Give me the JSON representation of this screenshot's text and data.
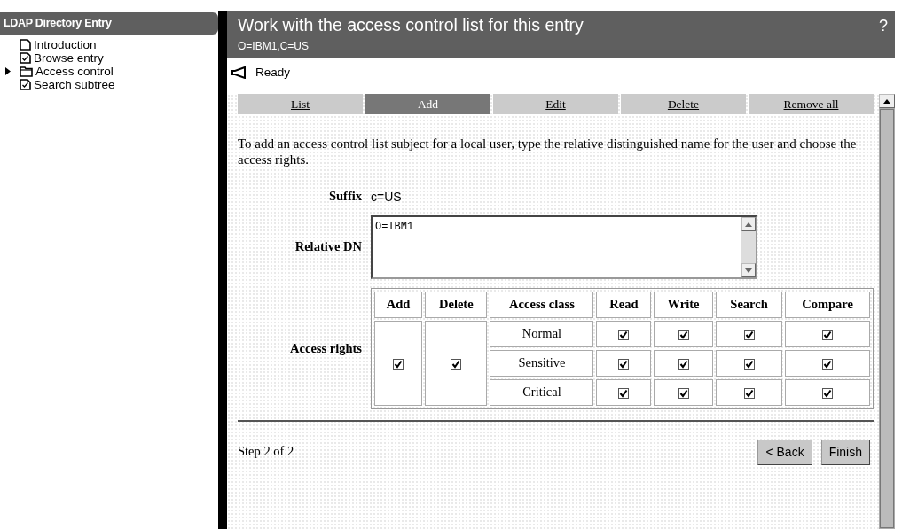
{
  "sidebar": {
    "title": "LDAP Directory Entry",
    "items": [
      {
        "label": "Introduction",
        "kind": "page"
      },
      {
        "label": "Browse entry",
        "kind": "checked-page"
      },
      {
        "label": "Access control",
        "kind": "folder"
      },
      {
        "label": "Search subtree",
        "kind": "checked-page"
      }
    ]
  },
  "header": {
    "title": "Work with the access control list for this entry",
    "subtitle": "O=IBM1,C=US",
    "help": "?"
  },
  "status": "Ready",
  "tabs": [
    {
      "label": "List",
      "selected": false
    },
    {
      "label": "Add",
      "selected": true
    },
    {
      "label": "Edit",
      "selected": false
    },
    {
      "label": "Delete",
      "selected": false
    },
    {
      "label": "Remove all",
      "selected": false
    }
  ],
  "instructions": "To add an access control list subject for a local user, type the relative distinguished name for the user and choose the access rights.",
  "suffix": {
    "label": "Suffix",
    "value": "c=US"
  },
  "relative_dn": {
    "label": "Relative DN",
    "value": "O=IBM1"
  },
  "access_rights": {
    "label": "Access rights",
    "columns": [
      "Add",
      "Delete",
      "Access class",
      "Read",
      "Write",
      "Search",
      "Compare"
    ],
    "add_checked": true,
    "delete_checked": true,
    "rows": [
      {
        "class": "Normal",
        "checks": [
          true,
          true,
          true,
          true
        ]
      },
      {
        "class": "Sensitive",
        "checks": [
          true,
          true,
          true,
          true
        ]
      },
      {
        "class": "Critical",
        "checks": [
          true,
          true,
          true,
          true
        ]
      }
    ]
  },
  "footer": {
    "step": "Step 2 of 2",
    "buttons": [
      "< Back",
      "Finish"
    ]
  }
}
